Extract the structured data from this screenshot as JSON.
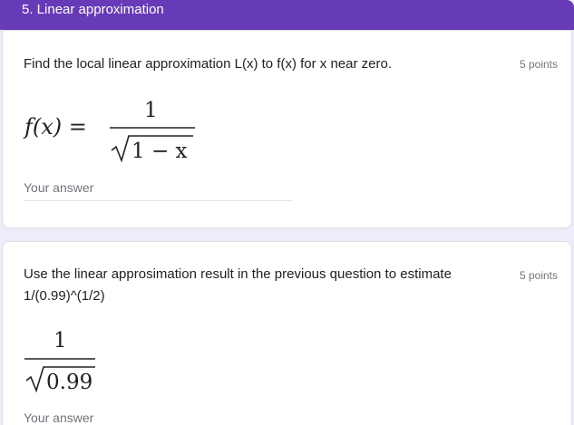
{
  "section": {
    "title": "5. Linear approximation"
  },
  "questions": [
    {
      "text": "Find the local linear approximation L(x) to f(x) for x near zero.",
      "points": "5 points",
      "formula": {
        "lhs": "f(x) =",
        "numerator": "1",
        "radicand": "1 − x"
      },
      "answer_placeholder": "Your answer"
    },
    {
      "text": "Use the linear approsimation result in the previous question to estimate",
      "text_line2": "1/(0.99)^(1/2)",
      "points": "5 points",
      "formula": {
        "numerator": "1",
        "radicand": "0.99"
      },
      "answer_placeholder": "Your answer"
    }
  ],
  "colors": {
    "header_bg": "#673ab7",
    "page_bg": "#f0ebf8",
    "card_bg": "#ffffff",
    "muted_text": "#70757a"
  }
}
